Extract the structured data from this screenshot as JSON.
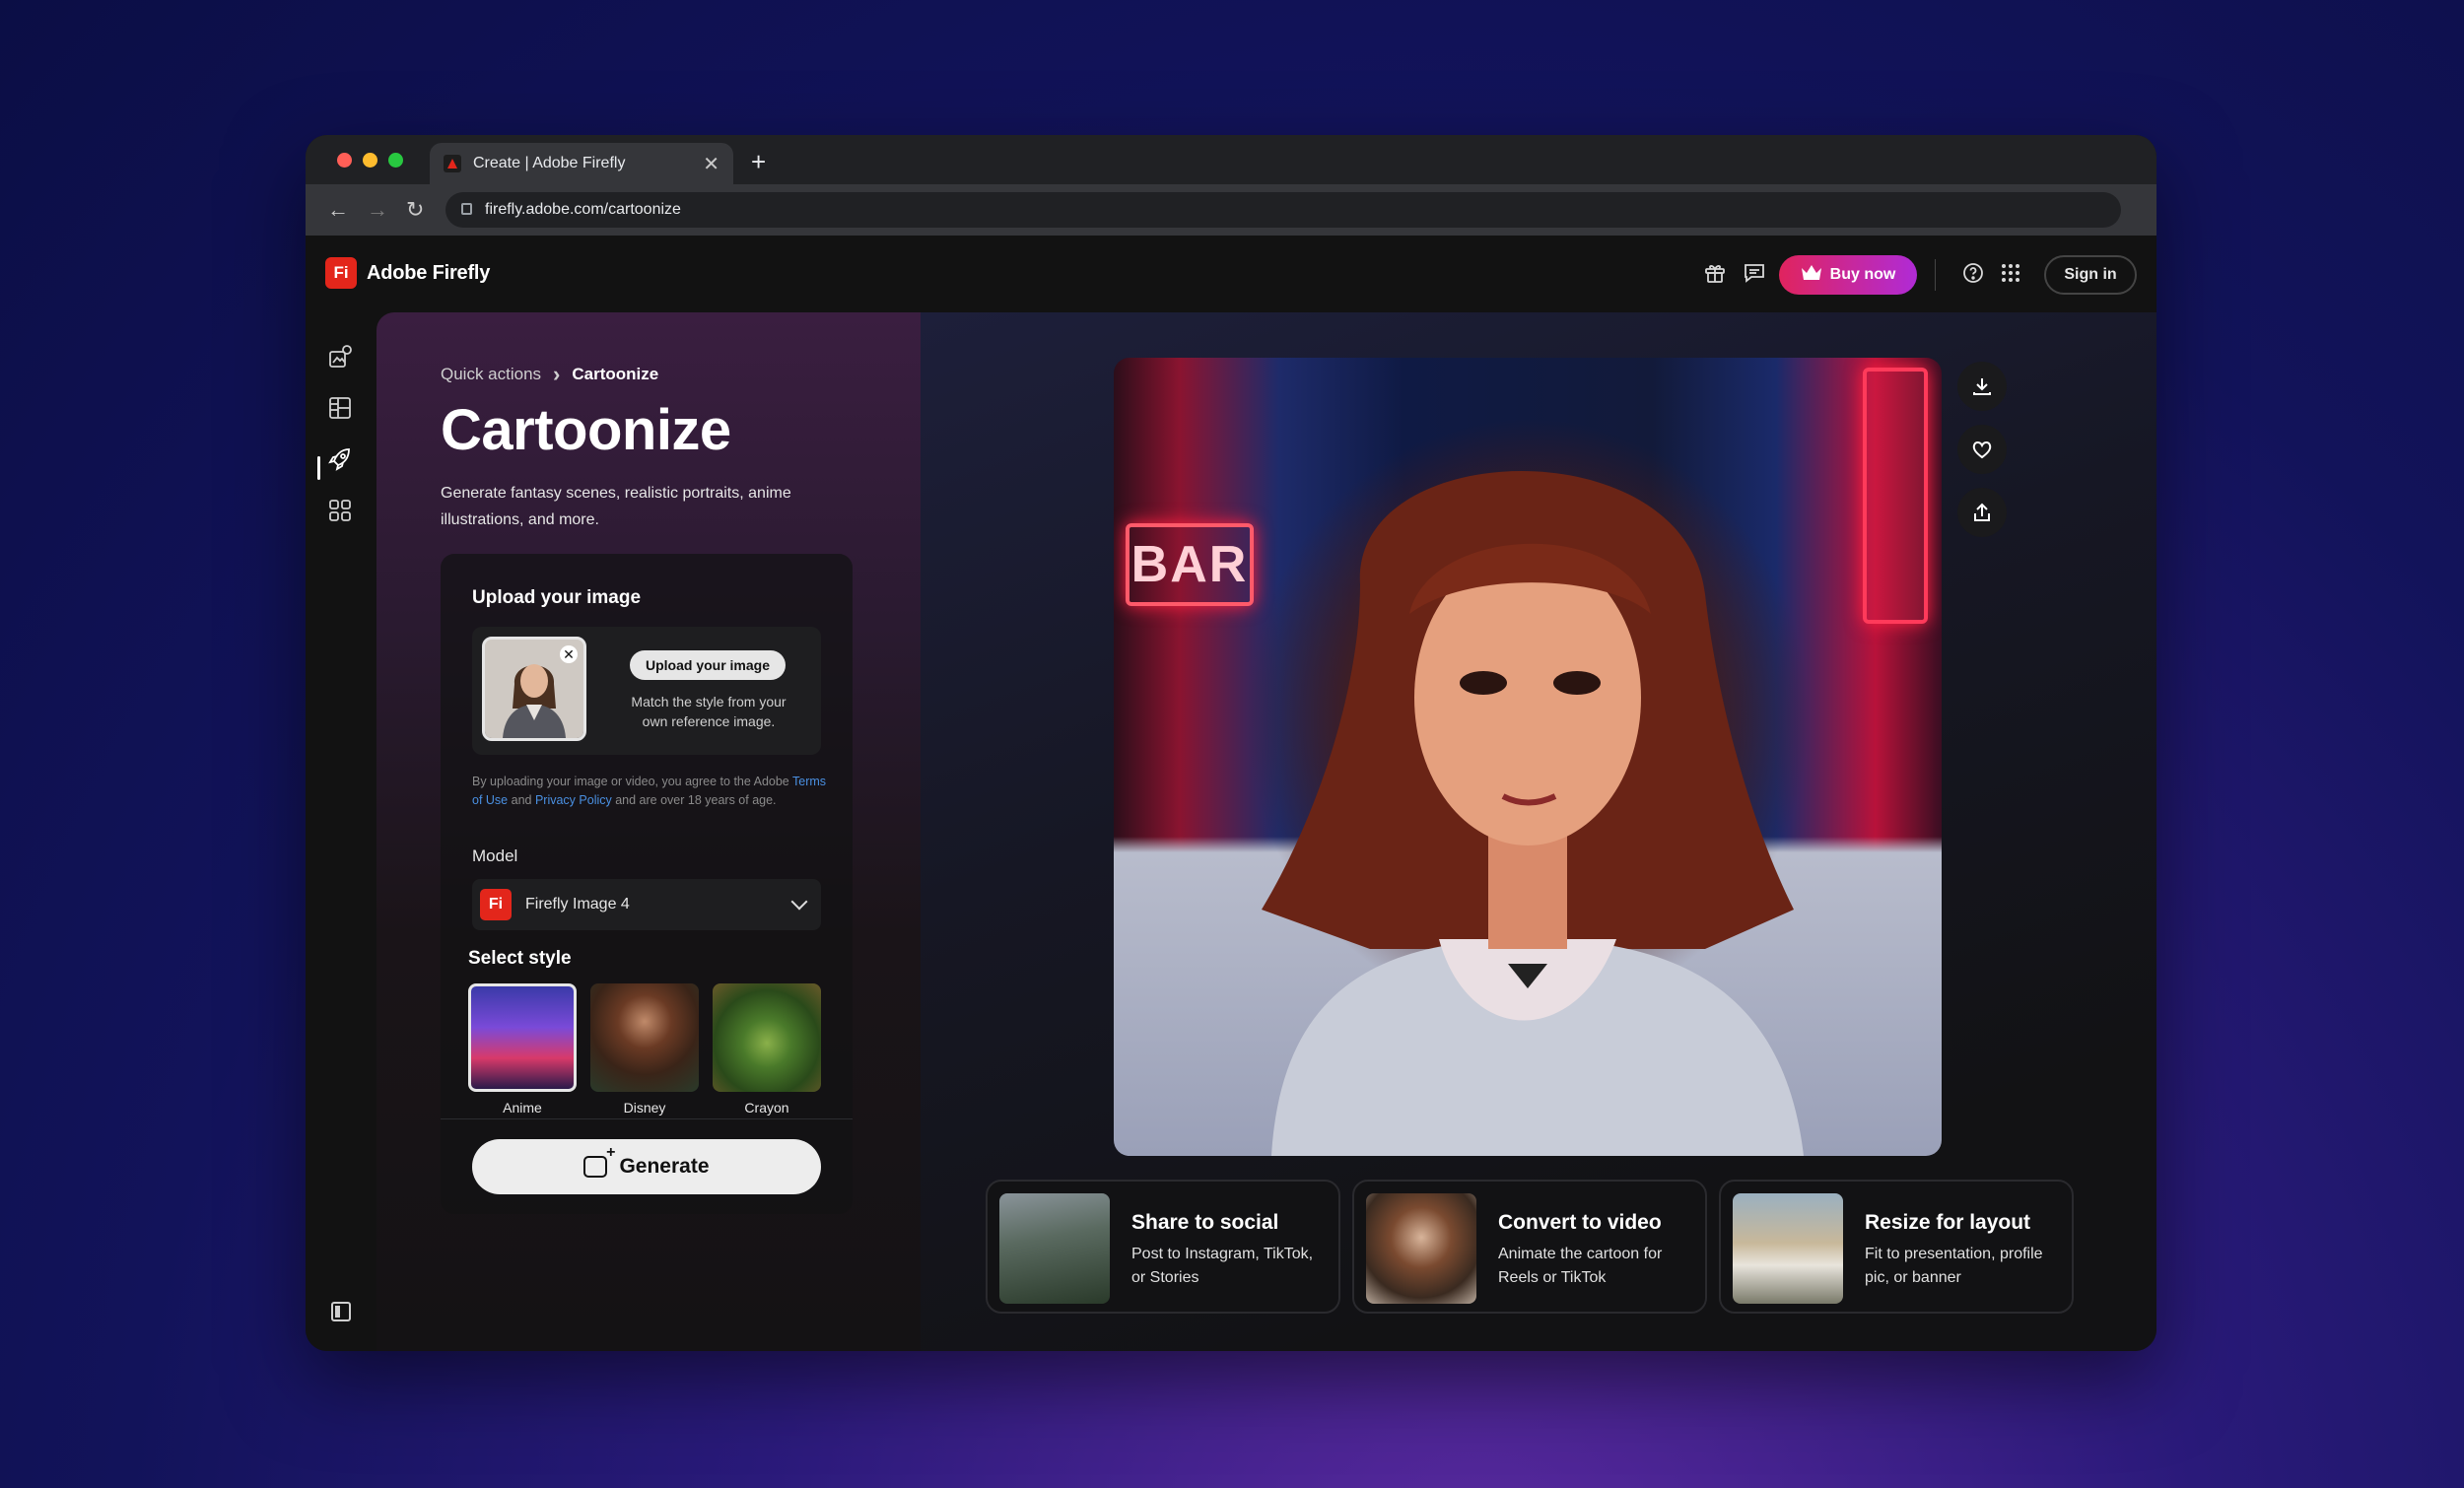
{
  "browser": {
    "tab_title": "Create | Adobe Firefly",
    "tab_close": "✕",
    "new_tab": "+",
    "url": "firefly.adobe.com/cartoonize",
    "traffic_lights": [
      "#ff5f57",
      "#febc2e",
      "#28c840"
    ]
  },
  "header": {
    "logo_mark": "Fi",
    "logo_text": "Adobe Firefly",
    "buy_now": "Buy now",
    "sign_in": "Sign in",
    "icons": [
      "gift-icon",
      "chat-icon",
      "crown-icon",
      "help-icon",
      "apps-grid-icon"
    ]
  },
  "sidebar": {
    "icons": [
      "generate-image-icon",
      "templates-icon",
      "quick-actions-icon",
      "assets-icon",
      "panel-toggle-icon"
    ],
    "active": "quick-actions-icon"
  },
  "breadcrumb": {
    "parent": "Quick actions",
    "separator": "›",
    "current": "Cartoonize"
  },
  "page": {
    "title": "Cartoonize",
    "description": "Generate fantasy scenes, realistic portraits, anime illustrations,  and more."
  },
  "upload": {
    "heading": "Upload your image",
    "button": "Upload your image",
    "hint": "Match the style from your own reference image.",
    "remove": "✕",
    "legal_pre": "By uploading your image or video, you agree to the Adobe ",
    "terms_link": "Terms of Use",
    "legal_and": " and ",
    "privacy_link": "Privacy Policy",
    "legal_post": " and are over 18 years of age."
  },
  "model": {
    "label": "Model",
    "mark": "Fi",
    "selected": "Firefly Image 4"
  },
  "styles": {
    "label": "Select style",
    "items": [
      {
        "name": "Anime",
        "selected": true
      },
      {
        "name": "Disney",
        "selected": false
      },
      {
        "name": "Crayon",
        "selected": false
      }
    ]
  },
  "generate_label": "Generate",
  "hero": {
    "sign_text": "BAR"
  },
  "actions": [
    "download-icon",
    "favorite-icon",
    "share-icon"
  ],
  "quick_actions": [
    {
      "title": "Share to social",
      "text": "Post to Instagram, TikTok, or Stories"
    },
    {
      "title": "Convert to video",
      "text": "Animate the cartoon for Reels or TikTok"
    },
    {
      "title": "Resize for layout",
      "text": "Fit to presentation, profile pic, or banner"
    }
  ],
  "colors": {
    "accent_red": "#e3261b",
    "buy_gradient_start": "#e0245e",
    "buy_gradient_end": "#b02bd6",
    "link_blue": "#4a90e2"
  }
}
